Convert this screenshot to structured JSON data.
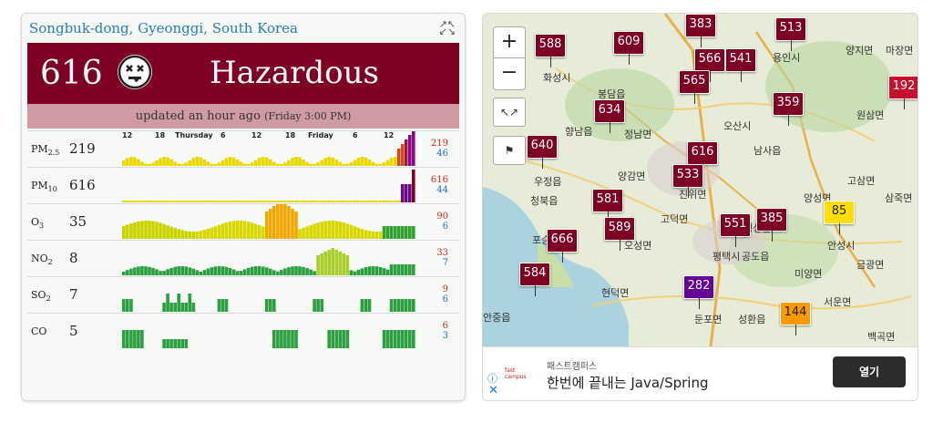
{
  "location": "Songbuk-dong, Gyeonggi, South Korea",
  "aqi": {
    "value": "616",
    "level": "Hazardous",
    "color": "#7e0023"
  },
  "updated": {
    "text": "updated an hour ago",
    "detail": "(Friday 3:00 PM)"
  },
  "time_ticks": [
    "12",
    "18",
    "Thursday",
    "6",
    "12",
    "18",
    "Friday",
    "6",
    "12"
  ],
  "pollutants": [
    {
      "name": "PM",
      "sub": "2.5",
      "value": "219",
      "max": "219",
      "min": "46"
    },
    {
      "name": "PM",
      "sub": "10",
      "value": "616",
      "max": "616",
      "min": "44"
    },
    {
      "name": "O",
      "sub": "3",
      "value": "35",
      "max": "90",
      "min": "6"
    },
    {
      "name": "NO",
      "sub": "2",
      "value": "8",
      "max": "33",
      "min": "7"
    },
    {
      "name": "SO",
      "sub": "2",
      "value": "7",
      "max": "9",
      "min": "6"
    },
    {
      "name": "CO",
      "sub": "",
      "value": "5",
      "max": "6",
      "min": "3"
    }
  ],
  "map": {
    "zoom_in": "+",
    "zoom_out": "−",
    "markers": [
      {
        "v": "588",
        "c": "#7e0023"
      },
      {
        "v": "609",
        "c": "#7e0023"
      },
      {
        "v": "383",
        "c": "#7e0023"
      },
      {
        "v": "513",
        "c": "#7e0023"
      },
      {
        "v": "566",
        "c": "#7e0023"
      },
      {
        "v": "541",
        "c": "#7e0023"
      },
      {
        "v": "565",
        "c": "#7e0023"
      },
      {
        "v": "192",
        "c": "#c8102e"
      },
      {
        "v": "634",
        "c": "#7e0023"
      },
      {
        "v": "359",
        "c": "#7e0023"
      },
      {
        "v": "640",
        "c": "#7e0023"
      },
      {
        "v": "616",
        "c": "#7e0023"
      },
      {
        "v": "533",
        "c": "#7e0023"
      },
      {
        "v": "581",
        "c": "#7e0023"
      },
      {
        "v": "589",
        "c": "#7e0023"
      },
      {
        "v": "666",
        "c": "#7e0023"
      },
      {
        "v": "551",
        "c": "#7e0023"
      },
      {
        "v": "385",
        "c": "#7e0023"
      },
      {
        "v": "85",
        "c": "#ffde00"
      },
      {
        "v": "584",
        "c": "#7e0023"
      },
      {
        "v": "282",
        "c": "#660099"
      },
      {
        "v": "144",
        "c": "#ff9900"
      }
    ],
    "places": [
      "화성시",
      "오산시",
      "용인시",
      "평택시",
      "안성시",
      "양지면",
      "마장면",
      "남사읍",
      "원삼면",
      "고삼면",
      "삼죽면",
      "양성면",
      "미양면",
      "금광면",
      "서운면",
      "팽성읍",
      "현덕면",
      "오성면",
      "고덕면",
      "진위면",
      "청북읍",
      "포승읍",
      "안중읍",
      "공도읍",
      "봉담읍",
      "향남읍",
      "양감면",
      "정남면",
      "우정읍",
      "백곡면",
      "성환읍",
      "둔포면"
    ]
  },
  "ad": {
    "brand": "패스트캠퍼스",
    "logo": "fast campus",
    "title": "한번에 끝내는 Java/Spring",
    "button": "열기"
  }
}
